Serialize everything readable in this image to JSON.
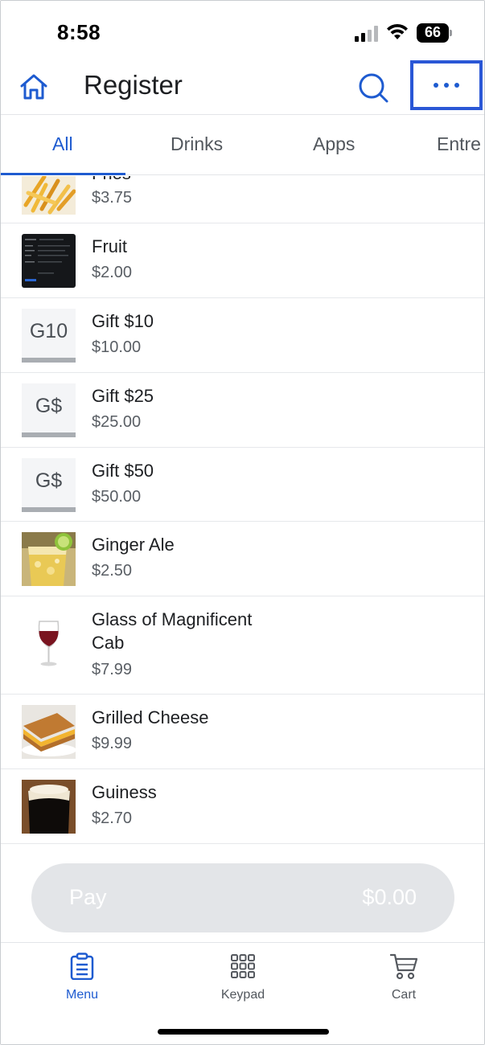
{
  "status_bar": {
    "time": "8:58",
    "battery": "66"
  },
  "header": {
    "title": "Register"
  },
  "tabs": [
    {
      "label": "All"
    },
    {
      "label": "Drinks"
    },
    {
      "label": "Apps"
    },
    {
      "label": "Entre"
    }
  ],
  "items": [
    {
      "name": "Fries",
      "price": "$3.75",
      "thumb": "fries-photo"
    },
    {
      "name": "Fruit",
      "price": "$2.00",
      "thumb": "screenshot-thumbnail"
    },
    {
      "name": "Gift $10",
      "price": "$10.00",
      "code": "G10"
    },
    {
      "name": "Gift $25",
      "price": "$25.00",
      "code": "G$"
    },
    {
      "name": "Gift $50",
      "price": "$50.00",
      "code": "G$"
    },
    {
      "name": "Ginger Ale",
      "price": "$2.50",
      "thumb": "ginger-ale-photo"
    },
    {
      "name_line1": "Glass of Magnificent",
      "name_line2": "Cab",
      "price": "$7.99",
      "thumb": "wine-glass-photo"
    },
    {
      "name": "Grilled Cheese",
      "price": "$9.99",
      "thumb": "grilled-cheese-photo"
    },
    {
      "name": "Guiness",
      "price": "$2.70",
      "thumb": "stout-photo"
    }
  ],
  "pay": {
    "label": "Pay",
    "amount": "$0.00"
  },
  "bottom_nav": [
    {
      "label": "Menu",
      "icon": "clipboard-icon"
    },
    {
      "label": "Keypad",
      "icon": "keypad-icon"
    },
    {
      "label": "Cart",
      "icon": "cart-icon"
    }
  ],
  "colors": {
    "accent": "#1e5bd0",
    "highlight_box": "#2a57d6",
    "pay_disabled": "#e3e5e8"
  }
}
